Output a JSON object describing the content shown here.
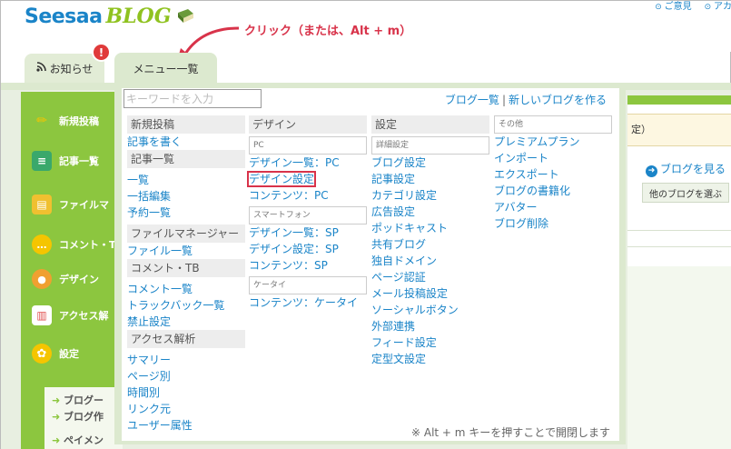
{
  "header": {
    "logo_main": "Seesaa",
    "logo_sub": "BLOG",
    "top_links": [
      "ご意見",
      "アカ"
    ],
    "annotation": "クリック（または、Alt + m）"
  },
  "tabs": {
    "notice_label": "お知らせ",
    "notice_badge": "!",
    "menu_label": "メニュー一覧"
  },
  "sidebar": {
    "items": [
      "新規投稿",
      "記事一覧",
      "ファイルマ",
      "コメント・T",
      "デザイン",
      "アクセス解",
      "設定"
    ],
    "sub_items": [
      "ブログー",
      "ブログ作",
      "ペイメン"
    ]
  },
  "right_panel": {
    "notice_text": "定）",
    "blog_link": "ブログを見る",
    "other_blog_button": "他のブログを選ぶ"
  },
  "menu": {
    "search_placeholder": "キーワードを入力",
    "blog_list_link": "ブログ一覧",
    "link_separator": "|",
    "new_blog_link": "新しいブログを作る",
    "col1": {
      "h1": "新規投稿",
      "new_post": "記事を書く",
      "h2": "記事一覧",
      "list": "一覧",
      "bulk_edit": "一括編集",
      "scheduled": "予約一覧",
      "h3": "ファイルマネージャー",
      "file_list": "ファイル一覧",
      "h4": "コメント・TB",
      "comment_list": "コメント一覧",
      "trackback_list": "トラックバック一覧",
      "ban_settings": "禁止設定",
      "h5": "アクセス解析",
      "summary": "サマリー",
      "per_page": "ページ別",
      "per_hour": "時間別",
      "referrer": "リンク元",
      "user_attr": "ユーザー属性"
    },
    "col2": {
      "h1": "デザイン",
      "pc": "PC",
      "design_list_pc": "デザイン一覧：PC",
      "design_settings": "デザイン設定",
      "contents_pc": "コンテンツ：PC",
      "sp": "スマートフォン",
      "design_list_sp": "デザイン一覧：SP",
      "design_settings_sp": "デザイン設定：SP",
      "contents_sp": "コンテンツ：SP",
      "ketai": "ケータイ",
      "contents_ketai": "コンテンツ：ケータイ"
    },
    "col3": {
      "h1": "設定",
      "detail": "詳細設定",
      "blog_settings": "ブログ設定",
      "post_settings": "記事設定",
      "category_settings": "カテゴリ設定",
      "ad_settings": "広告設定",
      "podcast": "ポッドキャスト",
      "shared_blog": "共有ブログ",
      "own_domain": "独自ドメイン",
      "page_auth": "ページ認証",
      "mail_post": "メール投稿設定",
      "social_button": "ソーシャルボタン",
      "external": "外部連携",
      "feed": "フィード設定",
      "template": "定型文設定"
    },
    "col4": {
      "h1": "その他",
      "premium": "プレミアムプラン",
      "import": "インポート",
      "export": "エクスポート",
      "book": "ブログの書籍化",
      "avatar": "アバター",
      "delete": "ブログ削除"
    },
    "footnote": "※ Alt + m キーを押すことで開閉します"
  },
  "colors": {
    "link": "#1a84c8",
    "accent_green": "#8cc63f",
    "annotation_red": "#d8334a"
  }
}
